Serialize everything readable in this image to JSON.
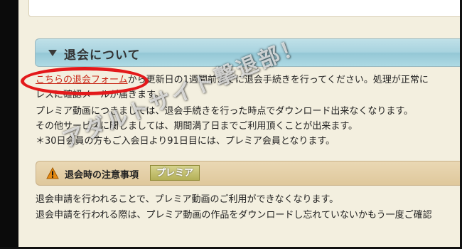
{
  "section": {
    "title": "退会について"
  },
  "body": {
    "link_text": "こちらの退会フォーム",
    "line1_rest": "から更新日の1週間前までに退会手続きを行ってください。処理が正常に",
    "line2": "レスに確認メールが届きます。",
    "line3": "プレミア動画につきましては、退会手続きを行った時点でダウンロード出来なくなります。",
    "line4": "その他サービスに関しましては、期間満了日までご利用頂くことが出来ます。",
    "line5": "＊30日会員の方もご入会日より91日目には、プレミア会員となります。"
  },
  "notice": {
    "title": "退会時の注意事項",
    "badge": "プレミア",
    "warning_icon": "warning-icon"
  },
  "notes": {
    "line1": "退会申請を行われることで、プレミア動画のご利用ができなくなります。",
    "line2": "退会申請を行われる際は、プレミア動画の作品をダウンロードし忘れていないかもう一度ご確認"
  },
  "watermark": {
    "text": "アダルトサイト撃退部！"
  },
  "colors": {
    "link": "#c82818",
    "highlight_oval": "#e3191b",
    "header_bg": "#a8d3df",
    "page_bg": "#f3efdf"
  }
}
